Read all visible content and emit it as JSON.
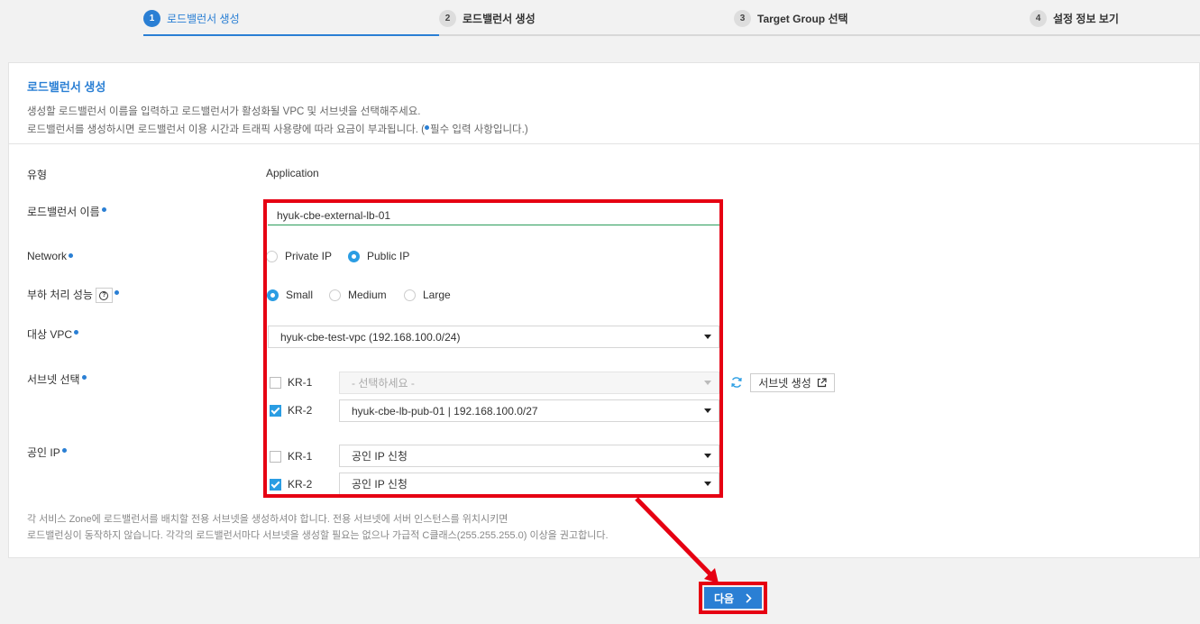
{
  "stepper": {
    "steps": [
      {
        "num": "1",
        "label": "로드밸런서 생성"
      },
      {
        "num": "2",
        "label": "로드밸런서 생성"
      },
      {
        "num": "3",
        "label": "Target Group 선택"
      },
      {
        "num": "4",
        "label": "설정 정보 보기"
      }
    ]
  },
  "header": {
    "title": "로드밸런서 생성",
    "desc1": "생성할 로드밸런서 이름을 입력하고 로드밸런서가 활성화될 VPC 및 서브넷을 선택해주세요.",
    "desc2_pre": "로드밸런서를 생성하시면 로드밸런서 이용 시간과 트래픽 사용량에 따라 요금이 부과됩니다. (",
    "desc2_post": "필수 입력 사항입니다.)"
  },
  "form": {
    "type_label": "유형",
    "type_value": "Application",
    "name_label": "로드밸런서 이름",
    "name_value": "hyuk-cbe-external-lb-01",
    "network_label": "Network",
    "network_options": [
      "Private IP",
      "Public IP"
    ],
    "capacity_label": "부하 처리 성능",
    "capacity_help": "?",
    "capacity_options": [
      "Small",
      "Medium",
      "Large"
    ],
    "vpc_label": "대상 VPC",
    "vpc_value": "hyuk-cbe-test-vpc (192.168.100.0/24)",
    "subnet_label": "서브넷 선택",
    "subnet_rows": [
      {
        "zone": "KR-1",
        "value": "- 선택하세요 -"
      },
      {
        "zone": "KR-2",
        "value": "hyuk-cbe-lb-pub-01 | 192.168.100.0/27"
      }
    ],
    "subnet_create_label": "서브넷 생성",
    "public_ip_label": "공인 IP",
    "public_ip_rows": [
      {
        "zone": "KR-1",
        "value": "공인 IP 신청"
      },
      {
        "zone": "KR-2",
        "value": "공인 IP 신청"
      }
    ],
    "note1": "각 서비스 Zone에 로드밸런서를 배치할 전용 서브넷을 생성하셔야 합니다. 전용 서브넷에 서버 인스턴스를 위치시키면",
    "note2": "로드밸런싱이 동작하지 않습니다. 각각의 로드밸런서마다 서브넷을 생성할 필요는 없으나 가급적 C클래스(255.255.255.0) 이상을 권고합니다."
  },
  "footer": {
    "next_label": "다음"
  },
  "colors": {
    "accent": "#2a7fd4",
    "highlight": "#e60012",
    "radio_on": "#2a9de3"
  }
}
